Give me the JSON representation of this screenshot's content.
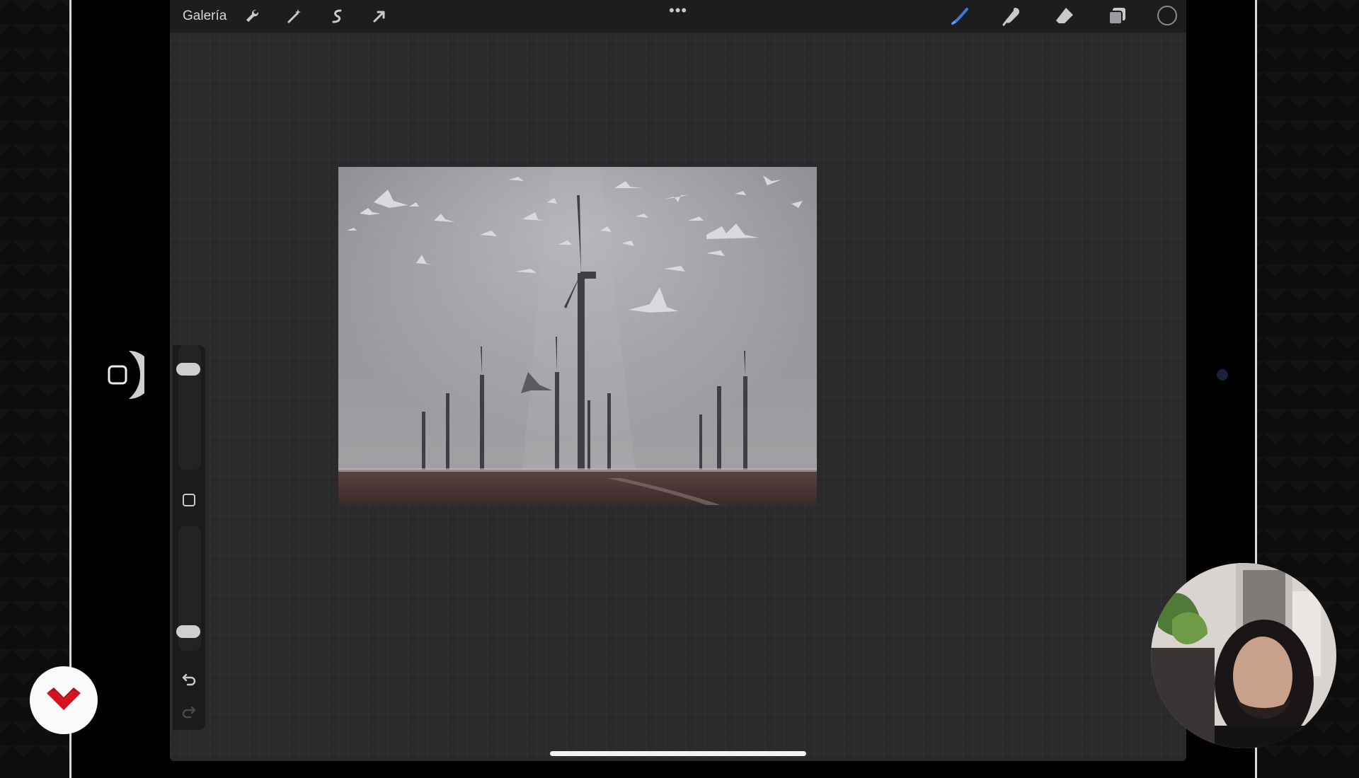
{
  "toolbar": {
    "gallery_label": "Galería",
    "more_label": "•••",
    "left_tools": [
      "wrench-icon",
      "magic-wand-icon",
      "selection-icon",
      "transform-arrow-icon"
    ],
    "right_tools": [
      "brush-icon",
      "smudge-icon",
      "eraser-icon",
      "layers-icon",
      "color-swatch"
    ],
    "current_color": "#1a1a1c",
    "brush_accent": "#3d7bd9"
  },
  "sidebar": {
    "brush_size": 0.85,
    "brush_opacity": 0.12,
    "controls": [
      "size-slider",
      "modify-button",
      "opacity-slider",
      "undo-icon",
      "redo-icon"
    ]
  },
  "canvas": {
    "artwork": "misty-wind-turbine-field-with-birds"
  }
}
